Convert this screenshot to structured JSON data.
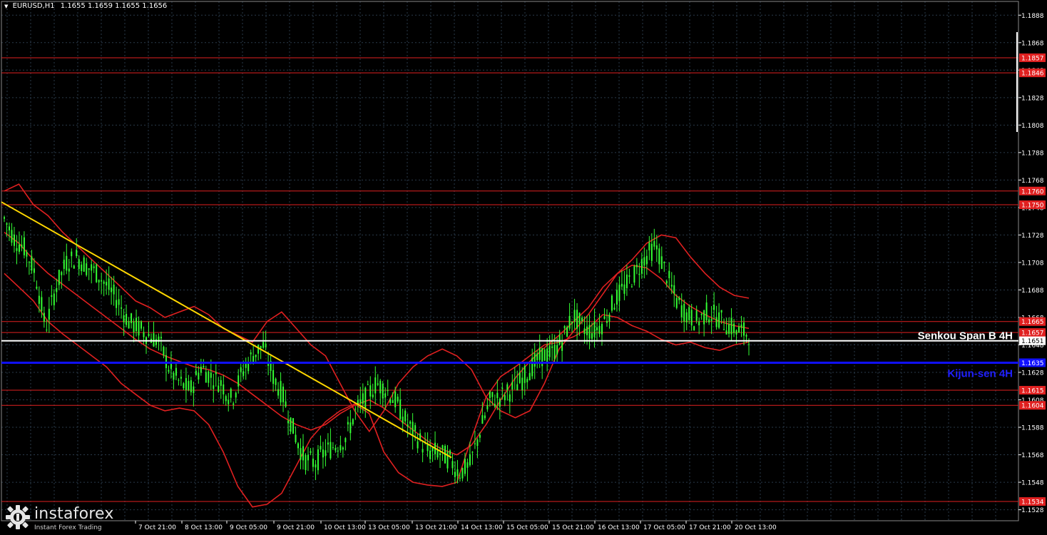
{
  "header": {
    "symbol": "EURUSD,H1",
    "ohlc": "1.1655 1.1659 1.1655 1.1656"
  },
  "brand": {
    "name": "instaforex",
    "tagline": "Instant Forex Trading"
  },
  "chart_data": {
    "type": "candlestick",
    "symbol": "EURUSD",
    "timeframe": "H1",
    "ylim": [
      1.152,
      1.1898
    ],
    "price_ticks": [
      "1.1888",
      "1.1868",
      "1.1848",
      "1.1828",
      "1.1808",
      "1.1788",
      "1.1768",
      "1.1748",
      "1.1728",
      "1.1708",
      "1.1688",
      "1.1668",
      "1.1648",
      "1.1628",
      "1.1608",
      "1.1588",
      "1.1568",
      "1.1548",
      "1.1528"
    ],
    "time_labels": [
      "7 Oct 21:00",
      "8 Oct 13:00",
      "9 Oct 05:00",
      "9 Oct 21:00",
      "10 Oct 13:00",
      "13 Oct 05:00",
      "13 Oct 21:00",
      "14 Oct 13:00",
      "15 Oct 05:00",
      "15 Oct 21:00",
      "16 Oct 13:00",
      "17 Oct 05:00",
      "17 Oct 21:00",
      "20 Oct 13:00"
    ],
    "levels": [
      {
        "price": 1.1857,
        "label": "1.1857",
        "color": "#e02020"
      },
      {
        "price": 1.1846,
        "label": "1.1846",
        "color": "#e02020"
      },
      {
        "price": 1.176,
        "label": "1.1760",
        "color": "#e02020"
      },
      {
        "price": 1.175,
        "label": "1.1750",
        "color": "#e02020"
      },
      {
        "price": 1.1665,
        "label": "1.1665",
        "color": "#e02020"
      },
      {
        "price": 1.1657,
        "label": "1.1657",
        "color": "#e02020"
      },
      {
        "price": 1.1615,
        "label": "1.1615",
        "color": "#e02020"
      },
      {
        "price": 1.1604,
        "label": "1.1604",
        "color": "#e02020"
      },
      {
        "price": 1.1534,
        "label": "1.1534",
        "color": "#e02020"
      }
    ],
    "ichimoku": [
      {
        "name": "Senkou Span B 4H",
        "price": 1.1651,
        "label": "1.1651",
        "color": "#ffffff"
      },
      {
        "name": "Kijun-sen 4H",
        "price": 1.1635,
        "label": "1.1635",
        "color": "#1010ff"
      }
    ],
    "trendline": {
      "color": "#ffd700",
      "from": {
        "time": "7 Oct 05:00",
        "price": 1.1752
      },
      "to": {
        "time": "14 Oct 05:00",
        "price": 1.1566
      }
    },
    "close_path": [
      1.174,
      1.1725,
      1.1718,
      1.17,
      1.166,
      1.169,
      1.1708,
      1.1712,
      1.1705,
      1.17,
      1.169,
      1.168,
      1.1665,
      1.166,
      1.1655,
      1.165,
      1.163,
      1.162,
      1.1615,
      1.1632,
      1.1625,
      1.162,
      1.1608,
      1.1628,
      1.164,
      1.1648,
      1.1625,
      1.161,
      1.1585,
      1.1565,
      1.1562,
      1.157,
      1.1575,
      1.158,
      1.16,
      1.161,
      1.162,
      1.1615,
      1.1605,
      1.159,
      1.158,
      1.157,
      1.157,
      1.1565,
      1.1555,
      1.156,
      1.1585,
      1.1608,
      1.161,
      1.1615,
      1.1622,
      1.1632,
      1.164,
      1.1642,
      1.1652,
      1.167,
      1.166,
      1.1658,
      1.1665,
      1.168,
      1.169,
      1.17,
      1.1712,
      1.172,
      1.17,
      1.168,
      1.167,
      1.1665,
      1.1672,
      1.1668,
      1.1662,
      1.1658,
      1.1656
    ],
    "bollinger": {
      "color": "#e02020",
      "upper": [
        1.176,
        1.1765,
        1.175,
        1.1742,
        1.173,
        1.172,
        1.171,
        1.17,
        1.169,
        1.168,
        1.1675,
        1.1668,
        1.1672,
        1.1676,
        1.167,
        1.166,
        1.1655,
        1.165,
        1.1665,
        1.1672,
        1.166,
        1.1648,
        1.164,
        1.162,
        1.16,
        1.1585,
        1.16,
        1.162,
        1.1632,
        1.164,
        1.1645,
        1.164,
        1.163,
        1.161,
        1.16,
        1.1595,
        1.16,
        1.162,
        1.1645,
        1.1658,
        1.167,
        1.1685,
        1.17,
        1.171,
        1.1722,
        1.1728,
        1.1726,
        1.1712,
        1.17,
        1.169,
        1.1684,
        1.1682
      ],
      "middle": [
        1.173,
        1.1722,
        1.171,
        1.17,
        1.1692,
        1.1684,
        1.1676,
        1.1668,
        1.166,
        1.1652,
        1.1645,
        1.164,
        1.1636,
        1.1632,
        1.163,
        1.1626,
        1.162,
        1.1612,
        1.1604,
        1.1596,
        1.159,
        1.1586,
        1.159,
        1.1598,
        1.1604,
        1.1608,
        1.1602,
        1.1594,
        1.1586,
        1.1578,
        1.1572,
        1.1568,
        1.1575,
        1.159,
        1.1608,
        1.1624,
        1.1636,
        1.1646,
        1.1655,
        1.1665,
        1.1675,
        1.169,
        1.17,
        1.1706,
        1.1704,
        1.1696,
        1.1684,
        1.1676,
        1.167,
        1.1665,
        1.1662,
        1.166
      ],
      "lower": [
        1.17,
        1.169,
        1.168,
        1.1665,
        1.1656,
        1.1648,
        1.164,
        1.1632,
        1.162,
        1.1612,
        1.1604,
        1.16,
        1.1602,
        1.16,
        1.159,
        1.157,
        1.1545,
        1.153,
        1.1532,
        1.154,
        1.156,
        1.158,
        1.1592,
        1.16,
        1.1605,
        1.1598,
        1.157,
        1.1555,
        1.1548,
        1.1546,
        1.1545,
        1.1548,
        1.158,
        1.161,
        1.1625,
        1.1632,
        1.164,
        1.1648,
        1.165,
        1.1654,
        1.166,
        1.167,
        1.1668,
        1.1662,
        1.1658,
        1.1652,
        1.1648,
        1.165,
        1.1646,
        1.1644,
        1.1648,
        1.165
      ]
    },
    "colors": {
      "background": "#000000",
      "grid": "#2a3a4a",
      "candles": "#33ff33",
      "axis_text": "#ffffff",
      "label_box": "#e02020"
    }
  }
}
